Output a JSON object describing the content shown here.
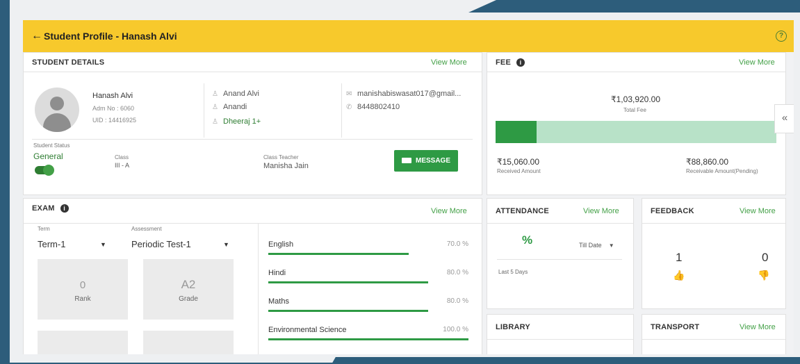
{
  "header": {
    "back_icon": "arrow-left-icon",
    "title": "Student Profile - Hanash Alvi",
    "help_icon": "question-circle-icon"
  },
  "student_details": {
    "heading": "STUDENT DETAILS",
    "view_more": "View More",
    "name": "Hanash Alvi",
    "adm_no": "Adm No : 6060",
    "uid": "UID : 14416925",
    "parents": [
      "Anand Alvi",
      "Anandi",
      "Dheeraj 1+"
    ],
    "email": "manishabiswasat017@gmail...",
    "phone": "8448802410",
    "status_label": "Student Status",
    "status_value": "General",
    "class_label": "Class",
    "class_value": "III - A",
    "teacher_label": "Class Teacher",
    "teacher_value": "Manisha Jain",
    "message_button": "MESSAGE"
  },
  "fee": {
    "heading": "FEE",
    "view_more": "View More",
    "total_amount": "₹1,03,920.00",
    "total_label": "Total Fee",
    "received_amount": "₹15,060.00",
    "received_label": "Received Amount",
    "receivable_amount": "₹88,860.00",
    "receivable_label": "Receivable Amount(Pending)",
    "received_fraction": 0.145
  },
  "exam": {
    "heading": "EXAM",
    "view_more": "View More",
    "term_label": "Term",
    "term_value": "Term-1",
    "assessment_label": "Assessment",
    "assessment_value": "Periodic Test-1",
    "rank_value": "0",
    "rank_label": "Rank",
    "grade_value": "A2",
    "grade_label": "Grade",
    "subjects": [
      {
        "name": "English",
        "percent": "70.0 %",
        "value": 70
      },
      {
        "name": "Hindi",
        "percent": "80.0 %",
        "value": 80
      },
      {
        "name": "Maths",
        "percent": "80.0 %",
        "value": 80
      },
      {
        "name": "Environmental Science",
        "percent": "100.0 %",
        "value": 100
      }
    ]
  },
  "attendance": {
    "heading": "ATTENDANCE",
    "view_more": "View More",
    "icon": "percent-icon",
    "range": "Till Date",
    "last_days": "Last 5 Days"
  },
  "feedback": {
    "heading": "FEEDBACK",
    "view_more": "View More",
    "positive": "1",
    "negative": "0"
  },
  "library": {
    "heading": "LIBRARY"
  },
  "transport": {
    "heading": "TRANSPORT",
    "view_more": "View More"
  },
  "collapse_icon": "chevron-double-left-icon",
  "colors": {
    "header": "#f7c92c",
    "accent_green": "#2e9a44",
    "bar_track": "#b8e2c8",
    "negative": "#e64a19"
  }
}
